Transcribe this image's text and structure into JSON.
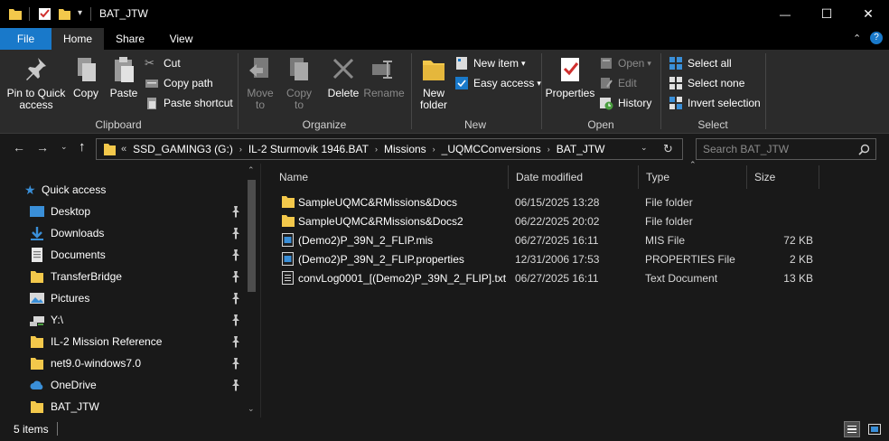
{
  "window": {
    "title": "BAT_JTW",
    "minimize_glyph": "—",
    "maximize_glyph": "☐",
    "close_glyph": "✕"
  },
  "ribbon_tabs": [
    {
      "label": "File"
    },
    {
      "label": "Home"
    },
    {
      "label": "Share"
    },
    {
      "label": "View"
    }
  ],
  "ribbon": {
    "clipboard": {
      "group_label": "Clipboard",
      "pin_to_quick_access": "Pin to Quick access",
      "copy": "Copy",
      "paste": "Paste",
      "cut": "Cut",
      "copy_path": "Copy path",
      "paste_shortcut": "Paste shortcut"
    },
    "organize": {
      "group_label": "Organize",
      "move_to": "Move to",
      "copy_to": "Copy to",
      "delete": "Delete",
      "rename": "Rename"
    },
    "new": {
      "group_label": "New",
      "new_folder": "New folder",
      "new_item": "New item",
      "easy_access": "Easy access"
    },
    "open": {
      "group_label": "Open",
      "properties": "Properties",
      "open": "Open",
      "edit": "Edit",
      "history": "History"
    },
    "select": {
      "group_label": "Select",
      "select_all": "Select all",
      "select_none": "Select none",
      "invert_selection": "Invert selection"
    }
  },
  "address": {
    "overflow": "«",
    "crumbs": [
      "SSD_GAMING3 (G:)",
      "IL-2 Sturmovik 1946.BAT",
      "Missions",
      "_UQMCConversions",
      "BAT_JTW"
    ],
    "search_placeholder": "Search BAT_JTW"
  },
  "sidebar": {
    "items": [
      {
        "label": "Quick access",
        "icon": "star-icon",
        "pinned": false
      },
      {
        "label": "Desktop",
        "icon": "desktop-icon",
        "pinned": true
      },
      {
        "label": "Downloads",
        "icon": "download-icon",
        "pinned": true
      },
      {
        "label": "Documents",
        "icon": "documents-icon",
        "pinned": true
      },
      {
        "label": "TransferBridge",
        "icon": "folder-icon",
        "pinned": true
      },
      {
        "label": "Pictures",
        "icon": "pictures-icon",
        "pinned": true
      },
      {
        "label": "Y:\\",
        "icon": "network-drive-icon",
        "pinned": true
      },
      {
        "label": "IL-2 Mission Reference",
        "icon": "folder-icon",
        "pinned": true
      },
      {
        "label": "net9.0-windows7.0",
        "icon": "folder-icon",
        "pinned": true
      },
      {
        "label": "OneDrive",
        "icon": "cloud-icon",
        "pinned": true
      },
      {
        "label": "BAT_JTW",
        "icon": "folder-icon",
        "pinned": false
      }
    ]
  },
  "file_list": {
    "columns": [
      "Name",
      "Date modified",
      "Type",
      "Size"
    ],
    "rows": [
      {
        "name": "SampleUQMC&RMissions&Docs",
        "date": "06/15/2025 13:28",
        "type": "File folder",
        "size": "",
        "icon": "folder-icon"
      },
      {
        "name": "SampleUQMC&RMissions&Docs2",
        "date": "06/22/2025 20:02",
        "type": "File folder",
        "size": "",
        "icon": "folder-icon"
      },
      {
        "name": "(Demo2)P_39N_2_FLIP.mis",
        "date": "06/27/2025 16:11",
        "type": "MIS File",
        "size": "72 KB",
        "icon": "mis-file-icon"
      },
      {
        "name": "(Demo2)P_39N_2_FLIP.properties",
        "date": "12/31/2006 17:53",
        "type": "PROPERTIES File",
        "size": "2 KB",
        "icon": "properties-file-icon"
      },
      {
        "name": "convLog0001_[(Demo2)P_39N_2_FLIP].txt",
        "date": "06/27/2025 16:11",
        "type": "Text Document",
        "size": "13 KB",
        "icon": "text-file-icon"
      }
    ]
  },
  "status": {
    "item_count": "5 items"
  },
  "colors": {
    "accent": "#1979ca",
    "folder": "#f3c84b",
    "background": "#191919",
    "ribbon": "#2b2b2b"
  }
}
